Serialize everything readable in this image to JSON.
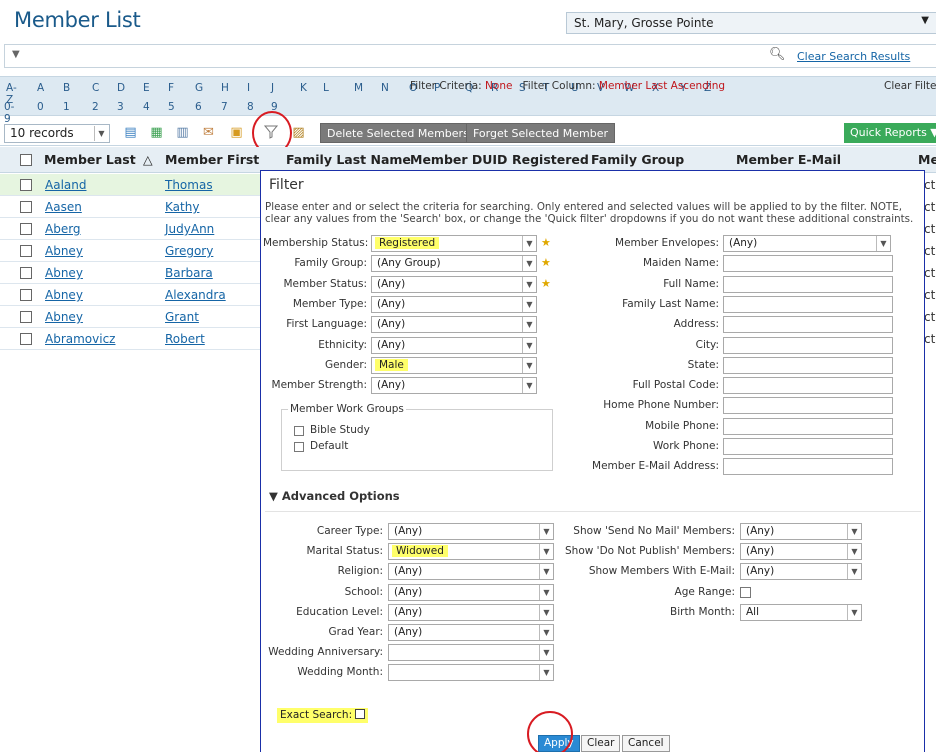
{
  "page": {
    "title": "Member List",
    "parish": "St. Mary, Grosse Pointe"
  },
  "search": {
    "clear_label": "Clear Search Results"
  },
  "alpha": {
    "row1": [
      "A-Z",
      "A",
      "B",
      "C",
      "D",
      "E",
      "F",
      "G",
      "H",
      "I",
      "J",
      "K",
      "L",
      "M",
      "N",
      "O",
      "P",
      "Q",
      "R",
      "S",
      "T",
      "U",
      "V",
      "W",
      "X",
      "Y",
      "Z"
    ],
    "row2": [
      "0-9",
      "0",
      "1",
      "2",
      "3",
      "4",
      "5",
      "6",
      "7",
      "8",
      "9"
    ],
    "criteria_label": "Filter Criteria:",
    "criteria_value": "None",
    "column_label": "Filter Column:",
    "column_value": "Member Last Ascending",
    "clear_filter": "Clear Filter"
  },
  "toolbar": {
    "records": "10 records",
    "delete_label": "Delete Selected Members",
    "forget_label": "Forget Selected Member",
    "quick_reports": "Quick Reports ▼"
  },
  "table": {
    "headers": [
      "Member Last",
      "Member First",
      "Family Last Name",
      "Member DUID",
      "Registered",
      "Family Group",
      "Member E-Mail",
      "Me"
    ],
    "sort_indicator": "△",
    "rows": [
      {
        "last": "Aaland",
        "first": "Thomas"
      },
      {
        "last": "Aasen",
        "first": "Kathy"
      },
      {
        "last": "Aberg",
        "first": "JudyAnn"
      },
      {
        "last": "Abney",
        "first": "Gregory"
      },
      {
        "last": "Abney",
        "first": "Barbara"
      },
      {
        "last": "Abney",
        "first": "Alexandra"
      },
      {
        "last": "Abney",
        "first": "Grant"
      },
      {
        "last": "Abramovicz",
        "first": "Robert"
      }
    ],
    "right_cut": "ct"
  },
  "filter": {
    "title": "Filter",
    "description": "Please enter and or select the criteria for searching. Only entered and selected values will be applied to by the filter. NOTE, clear any values from the 'Search' box, or change the 'Quick filter' dropdowns if you do not want these additional constraints.",
    "left": [
      {
        "label": "Membership Status:",
        "value": "Registered",
        "highlight": true,
        "star": true
      },
      {
        "label": "Family Group:",
        "value": "(Any Group)",
        "star": true
      },
      {
        "label": "Member Status:",
        "value": "(Any)",
        "star": true
      },
      {
        "label": "Member Type:",
        "value": "(Any)"
      },
      {
        "label": "First Language:",
        "value": "(Any)"
      },
      {
        "label": "Ethnicity:",
        "value": "(Any)"
      },
      {
        "label": "Gender:",
        "value": "Male",
        "highlight": true
      },
      {
        "label": "Member Strength:",
        "value": "(Any)"
      }
    ],
    "right": [
      {
        "label": "Member Envelopes:",
        "value": "(Any)",
        "type": "select"
      },
      {
        "label": "Maiden Name:",
        "type": "input"
      },
      {
        "label": "Full Name:",
        "type": "input"
      },
      {
        "label": "Family Last Name:",
        "type": "input"
      },
      {
        "label": "Address:",
        "type": "input"
      },
      {
        "label": "City:",
        "type": "input"
      },
      {
        "label": "State:",
        "type": "input"
      },
      {
        "label": "Full Postal Code:",
        "type": "input"
      },
      {
        "label": "Home Phone Number:",
        "type": "input"
      },
      {
        "label": "Mobile Phone:",
        "type": "input"
      },
      {
        "label": "Work Phone:",
        "type": "input"
      },
      {
        "label": "Member E-Mail Address:",
        "type": "input"
      }
    ],
    "work_groups": {
      "legend": "Member Work Groups",
      "items": [
        "Bible Study",
        "Default"
      ]
    },
    "advanced_label": "▼ Advanced Options",
    "adv_left": [
      {
        "label": "Career Type:",
        "value": "(Any)"
      },
      {
        "label": "Marital Status:",
        "value": "Widowed",
        "highlight": true
      },
      {
        "label": "Religion:",
        "value": "(Any)"
      },
      {
        "label": "School:",
        "value": "(Any)"
      },
      {
        "label": "Education Level:",
        "value": "(Any)"
      },
      {
        "label": "Grad Year:",
        "value": "(Any)"
      },
      {
        "label": "Wedding Anniversary:",
        "value": ""
      },
      {
        "label": "Wedding Month:",
        "value": ""
      }
    ],
    "adv_right": [
      {
        "label": "Show 'Send No Mail' Members:",
        "value": "(Any)",
        "type": "select"
      },
      {
        "label": "Show 'Do Not Publish' Members:",
        "value": "(Any)",
        "type": "select"
      },
      {
        "label": "Show Members With E-Mail:",
        "value": "(Any)",
        "type": "select"
      },
      {
        "label": "Age Range:",
        "type": "checkbox"
      },
      {
        "label": "Birth Month:",
        "value": "All",
        "type": "select"
      }
    ],
    "exact_search": "Exact Search:",
    "buttons": {
      "apply": "Apply",
      "clear": "Clear",
      "cancel": "Cancel"
    }
  },
  "colors": {
    "accent": "#1565a6",
    "highlight": "#ffff6a",
    "annotation": "#d81b22",
    "dialog_border": "#1a2fa8"
  }
}
